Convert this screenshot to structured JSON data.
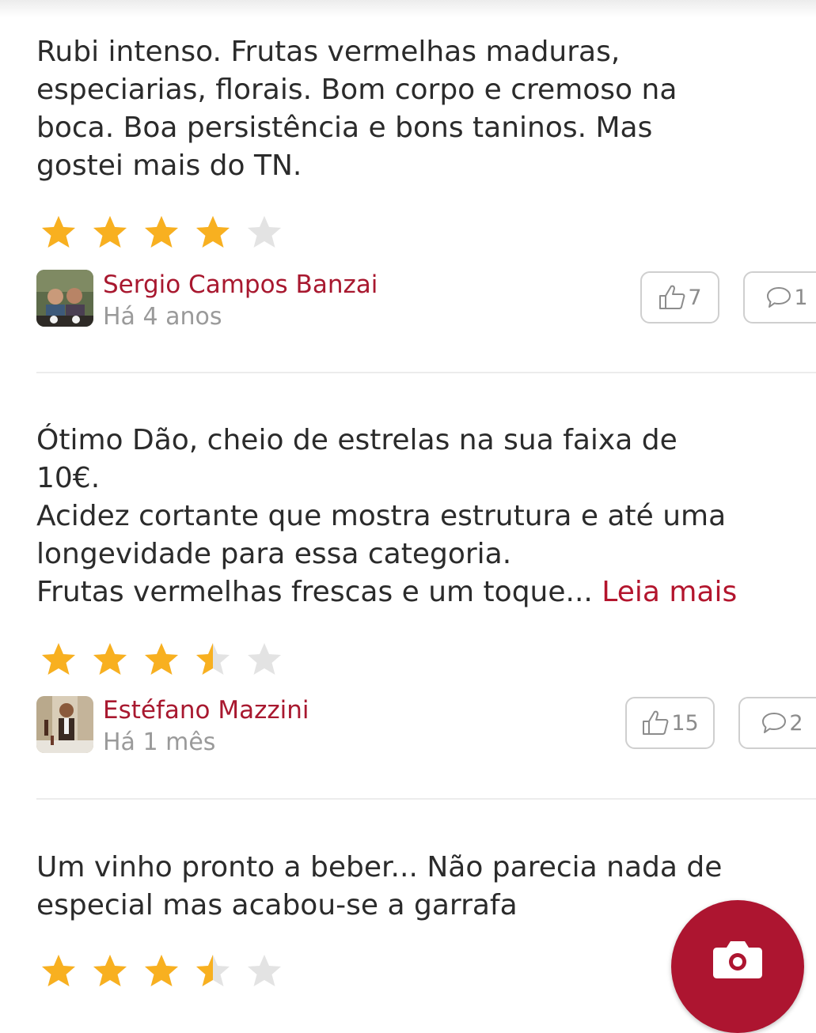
{
  "reviews": [
    {
      "text": "Rubi intenso. Frutas vermelhas maduras,\nespeciarias, florais. Bom corpo e cremoso na\nboca. Boa persistência e bons taninos. Mas\ngostei mais do TN.",
      "rating": 4,
      "author": "Sergio Campos Banzai",
      "time": "Há 4 anos",
      "likes": "7",
      "comments": "1"
    },
    {
      "text": "Ótimo Dão, cheio de estrelas na sua faixa de\n10€.\nAcidez cortante que mostra estrutura e até uma\nlongevidade para essa categoria.\nFrutas vermelhas frescas e um toque...",
      "read_more": " Leia mais",
      "rating": 3.5,
      "author": "Estéfano Mazzini",
      "time": "Há 1 mês",
      "likes": "15",
      "comments": "2"
    },
    {
      "text": "Um vinho pronto a beber... Não parecia nada de\nespecial mas acabou-se a garrafa",
      "rating": 3.5
    }
  ],
  "icons": {
    "star": "star-icon",
    "like": "thumbs-up-icon",
    "comment": "comment-bubble-icon",
    "fab": "camera-icon"
  },
  "colors": {
    "accent": "#b3152d",
    "star_filled": "#f8b020",
    "star_empty": "#e3e3e3",
    "muted_text": "#9a9a9a",
    "fab": "#ad1530"
  }
}
